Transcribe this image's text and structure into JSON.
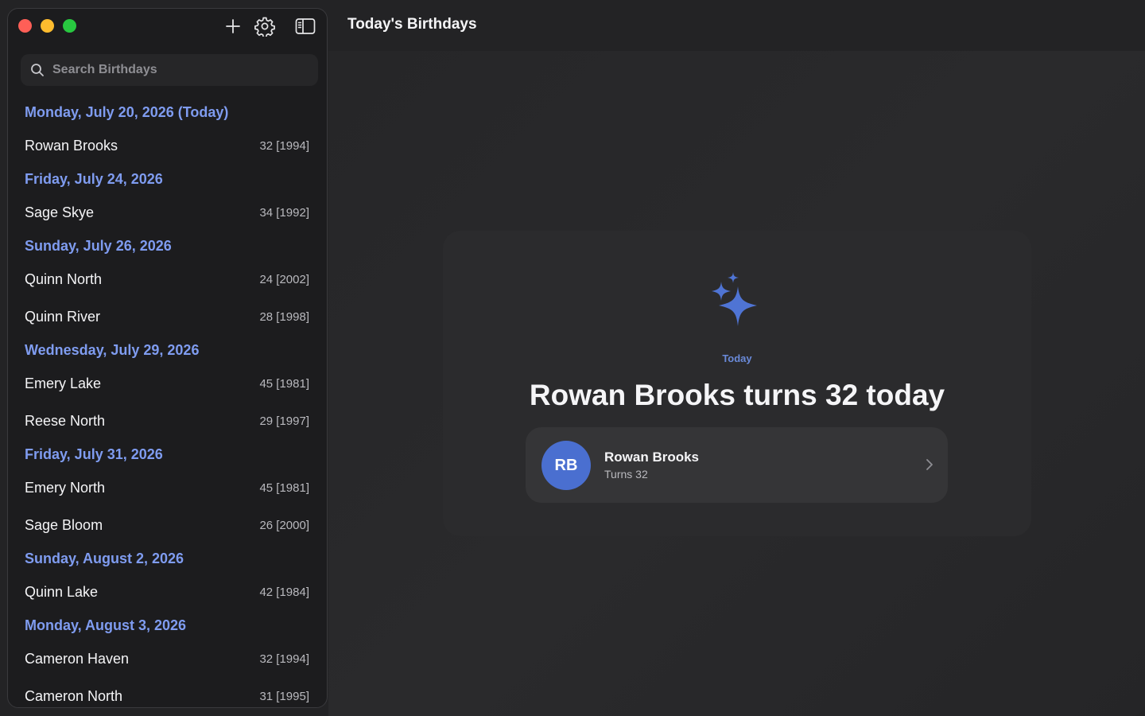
{
  "sidebar": {
    "search_placeholder": "Search Birthdays",
    "groups": [
      {
        "header": "Monday, July 20, 2026  (Today)",
        "rows": [
          {
            "name": "Rowan Brooks",
            "age": "32 [1994]"
          }
        ]
      },
      {
        "header": "Friday, July 24, 2026",
        "rows": [
          {
            "name": "Sage Skye",
            "age": "34 [1992]"
          }
        ]
      },
      {
        "header": "Sunday, July 26, 2026",
        "rows": [
          {
            "name": "Quinn North",
            "age": "24 [2002]"
          },
          {
            "name": "Quinn River",
            "age": "28 [1998]"
          }
        ]
      },
      {
        "header": "Wednesday, July 29, 2026",
        "rows": [
          {
            "name": "Emery Lake",
            "age": "45 [1981]"
          },
          {
            "name": "Reese North",
            "age": "29 [1997]"
          }
        ]
      },
      {
        "header": "Friday, July 31, 2026",
        "rows": [
          {
            "name": "Emery North",
            "age": "45 [1981]"
          },
          {
            "name": "Sage Bloom",
            "age": "26 [2000]"
          }
        ]
      },
      {
        "header": "Sunday, August 2, 2026",
        "rows": [
          {
            "name": "Quinn Lake",
            "age": "42 [1984]"
          }
        ]
      },
      {
        "header": "Monday, August 3, 2026",
        "rows": [
          {
            "name": "Cameron Haven",
            "age": "32 [1994]"
          },
          {
            "name": "Cameron North",
            "age": "31 [1995]"
          }
        ]
      }
    ]
  },
  "main": {
    "title": "Today's Birthdays",
    "today_label": "Today",
    "headline": "Rowan Brooks turns 32 today",
    "person": {
      "initials": "RB",
      "name": "Rowan Brooks",
      "subtitle": "Turns 32"
    }
  },
  "icons": {
    "add": "plus-icon",
    "settings": "gear-icon",
    "sidebar_toggle": "sidebar-icon",
    "search": "magnifier-icon",
    "sparkle": "sparkles-icon",
    "chevron": "chevron-right-icon"
  },
  "colors": {
    "accent": "#7f9cf0",
    "avatar": "#4a6fd0",
    "sparkle": "#4f74d4"
  }
}
